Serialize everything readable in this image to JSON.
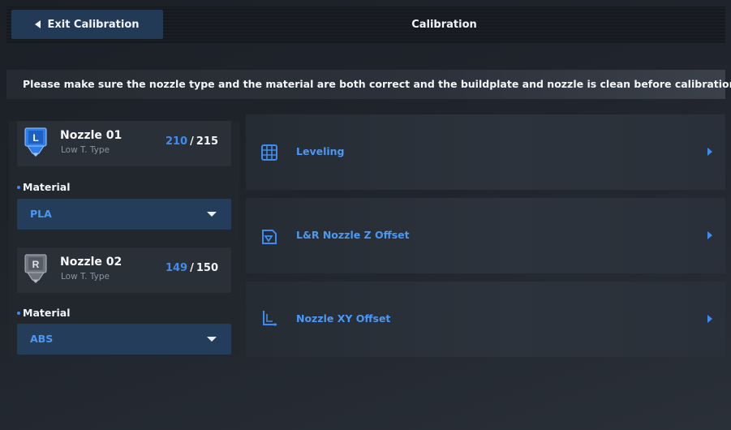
{
  "header": {
    "exit_label": "Exit Calibration",
    "title": "Calibration"
  },
  "notice": "Please make sure the nozzle type and the material are both correct and the buildplate and nozzle is clean before calibration.",
  "nozzles": [
    {
      "badge": "L",
      "name": "Nozzle 01",
      "type": "Low T. Type",
      "current_temp": "210",
      "separator": "/",
      "target_temp": "215",
      "material_label": "Material",
      "material_value": "PLA"
    },
    {
      "badge": "R",
      "name": "Nozzle 02",
      "type": "Low T. Type",
      "current_temp": "149",
      "separator": "/",
      "target_temp": "150",
      "material_label": "Material",
      "material_value": "ABS"
    }
  ],
  "calibration_items": [
    {
      "label": "Leveling",
      "icon": "grid-icon"
    },
    {
      "label": "L&R Nozzle Z Offset",
      "icon": "z-offset-icon"
    },
    {
      "label": "Nozzle XY Offset",
      "icon": "xy-offset-icon"
    }
  ],
  "colors": {
    "accent": "#3f8cf0",
    "select_bg": "#243d5b",
    "badge_active": "#2f7de8",
    "badge_inactive": "#6f7680"
  }
}
